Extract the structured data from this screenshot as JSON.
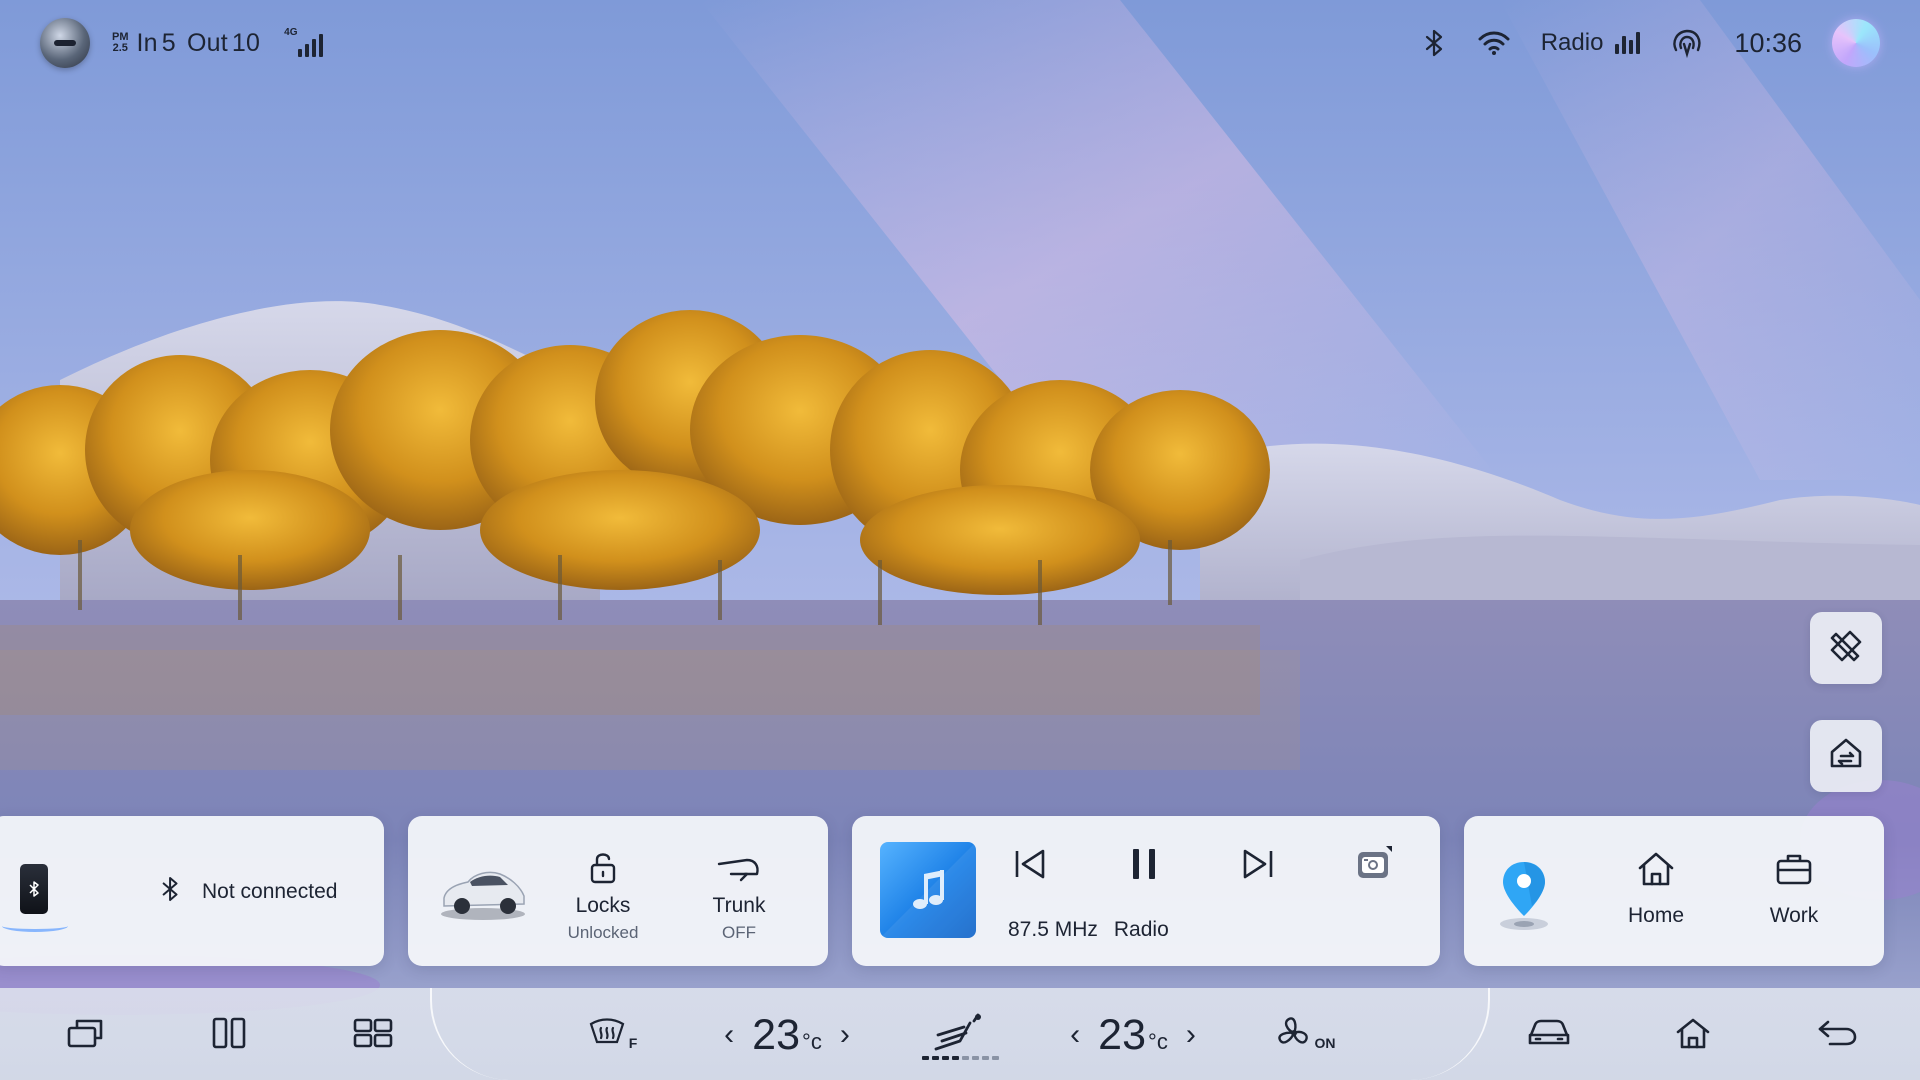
{
  "status_bar": {
    "pm_label_top": "PM",
    "pm_label_bottom": "2.5",
    "air_in_label": "In",
    "air_in_value": "5",
    "air_out_label": "Out",
    "air_out_value": "10",
    "network_label": "4G",
    "radio_label": "Radio",
    "time": "10:36"
  },
  "phone_card": {
    "bluetooth_status": "Not connected"
  },
  "vehicle_card": {
    "locks_label": "Locks",
    "locks_state": "Unlocked",
    "trunk_label": "Trunk",
    "trunk_state": "OFF"
  },
  "media_card": {
    "frequency": "87.5 MHz",
    "source": "Radio"
  },
  "nav_card": {
    "home_label": "Home",
    "work_label": "Work"
  },
  "dock": {
    "defrost_tag": "F",
    "left_temp": "23",
    "right_temp": "23",
    "temp_unit": "°c",
    "fan_tag": "ON",
    "fan_level": 0.5
  },
  "colors": {
    "sky_top": "#8fa6dc",
    "sky_pink": "#d6b4e6",
    "trees": "#d89a1f",
    "water": "#7f86b8",
    "accent_blue": "#1b7fe6",
    "pin_blue": "#2fa6f5"
  },
  "icons": {
    "side_top": "tools-icon",
    "side_bottom": "home-switch-icon",
    "dock": [
      "window-icon",
      "split-view-icon",
      "grid-icon",
      "defrost-icon",
      "seat-airflow-icon",
      "fan-icon",
      "car-icon",
      "home-icon",
      "back-icon"
    ]
  }
}
